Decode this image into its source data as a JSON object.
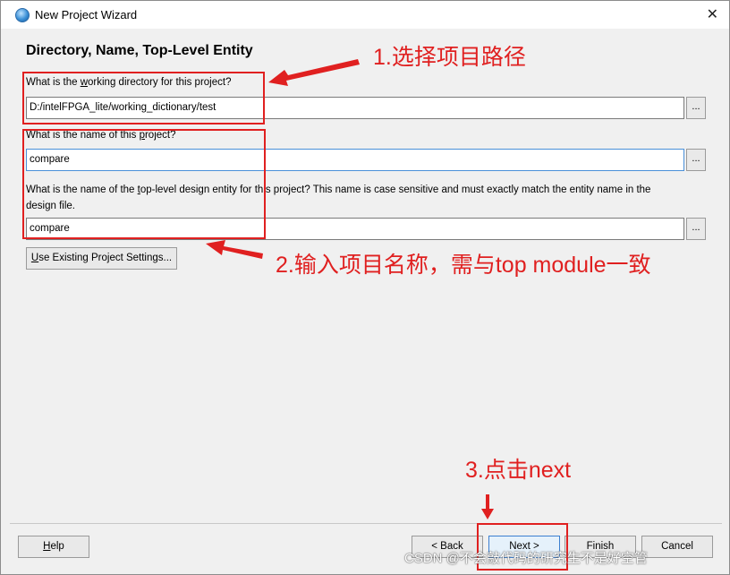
{
  "window": {
    "title": "New Project Wizard",
    "close_glyph": "✕"
  },
  "page": {
    "heading": "Directory, Name, Top-Level Entity"
  },
  "fields": {
    "dir_label_pre": "What is the ",
    "dir_label_key": "w",
    "dir_label_post": "orking directory for this project?",
    "dir_value": "D:/intelFPGA_lite/working_dictionary/test",
    "name_label_pre": "What is the name of this ",
    "name_label_key": "p",
    "name_label_post": "roject?",
    "name_value": "compare",
    "entity_label_pre": "What is the name of the ",
    "entity_label_key": "t",
    "entity_label_post": "op-level design entity for this project? This name is case sensitive and must exactly match the entity name in the",
    "entity_label_line2": "design file.",
    "entity_value": "compare",
    "browse_label": "..."
  },
  "buttons": {
    "use_existing_key": "U",
    "use_existing_rest": "se Existing Project Settings...",
    "help_key": "H",
    "help_rest": "elp",
    "back": "< Back",
    "next": "Next >",
    "finish": "Finish",
    "cancel": "Cancel"
  },
  "annotations": {
    "step1": "1.选择项目路径",
    "step2": "2.输入项目名称，需与top module一致",
    "step3": "3.点击next",
    "color": "#e02020"
  },
  "watermark": "CSDN @不会敲代码的研究生不是好空管"
}
